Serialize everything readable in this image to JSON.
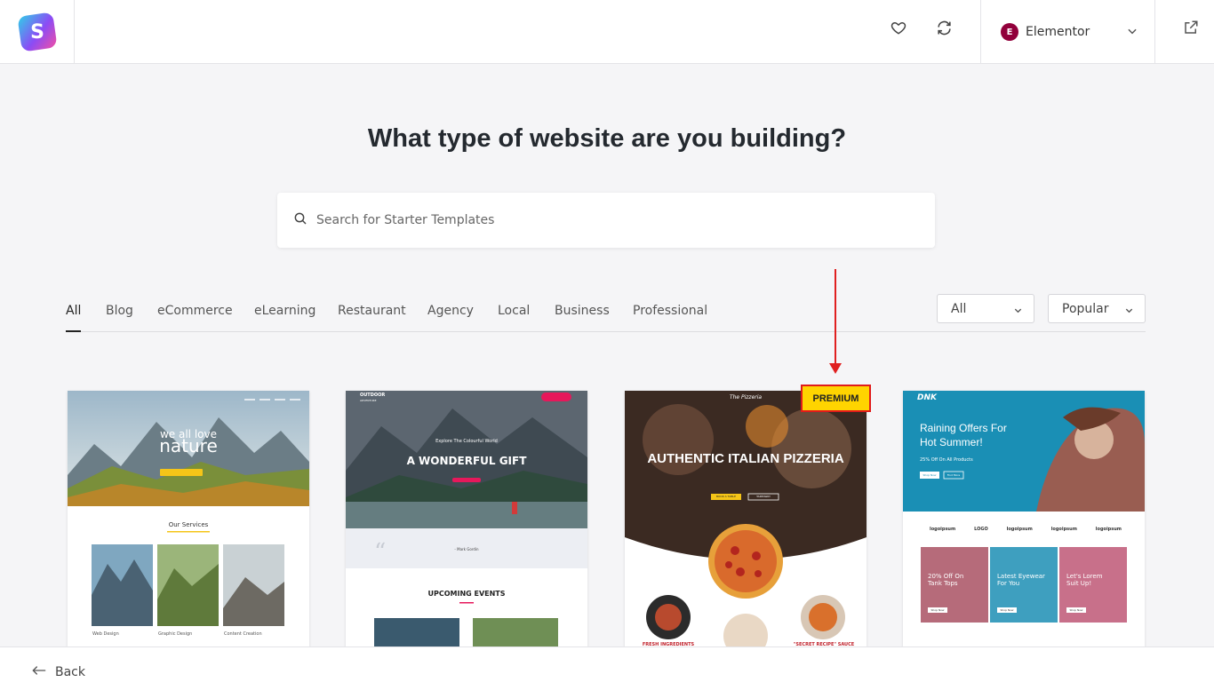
{
  "header": {
    "logo_letter": "S",
    "builder": {
      "icon_text": "E",
      "label": "Elementor"
    },
    "icons": [
      "heart-icon",
      "refresh-icon",
      "external-link-icon"
    ]
  },
  "main": {
    "title": "What type of website are you building?",
    "search": {
      "placeholder": "Search for Starter Templates",
      "value": ""
    }
  },
  "tabs": {
    "items": [
      "All",
      "Blog",
      "eCommerce",
      "eLearning",
      "Restaurant",
      "Agency",
      "Local",
      "Business",
      "Professional"
    ],
    "active": "All"
  },
  "filters": {
    "type_select": "All",
    "sort_select": "Popular"
  },
  "cards": [
    {
      "hero_small": "we all love",
      "hero_big": "nature",
      "section_title": "Our Services",
      "captions": [
        "Web Design",
        "Graphic Design",
        "Content Creation"
      ]
    },
    {
      "brand_top": "OUTDOOR",
      "brand_sub": "ADVENTURE",
      "hero_small": "Explore The Colourful World",
      "hero_big": "A WONDERFUL GIFT",
      "quote_author": "- Mark Gordin",
      "section_title": "UPCOMING EVENTS"
    },
    {
      "badge": "PREMIUM",
      "brand": "The Pizzeria",
      "hero_big": "AUTHENTIC ITALIAN PIZZERIA",
      "btn1": "BOOK A TABLE",
      "btn2": "TAKEAWAY",
      "caption_left": "FRESH INGREDIENTS",
      "caption_right": "\"SECRET RECIPE\" SAUCE"
    },
    {
      "brand": "DNK",
      "hero_title_1": "Raining Offers For",
      "hero_title_2": "Hot Summer!",
      "hero_sub": "25% Off On All Products",
      "btn1": "Shop Now",
      "btn2": "Find More",
      "logos": [
        "logoipsum",
        "LOGO",
        "logoipsum",
        "logoipsum",
        "logoipsum"
      ],
      "promo": [
        "20% Off On Tank Tops",
        "Latest Eyewear For You",
        "Let's Lorem Suit Up!"
      ],
      "promo_btn": "Shop Now"
    }
  ],
  "footer": {
    "back_label": "Back"
  },
  "colors": {
    "accent_red": "#e02020",
    "premium_yellow": "#ffd400",
    "elementor": "#92003b",
    "dnk_blue": "#1a8fb5"
  }
}
